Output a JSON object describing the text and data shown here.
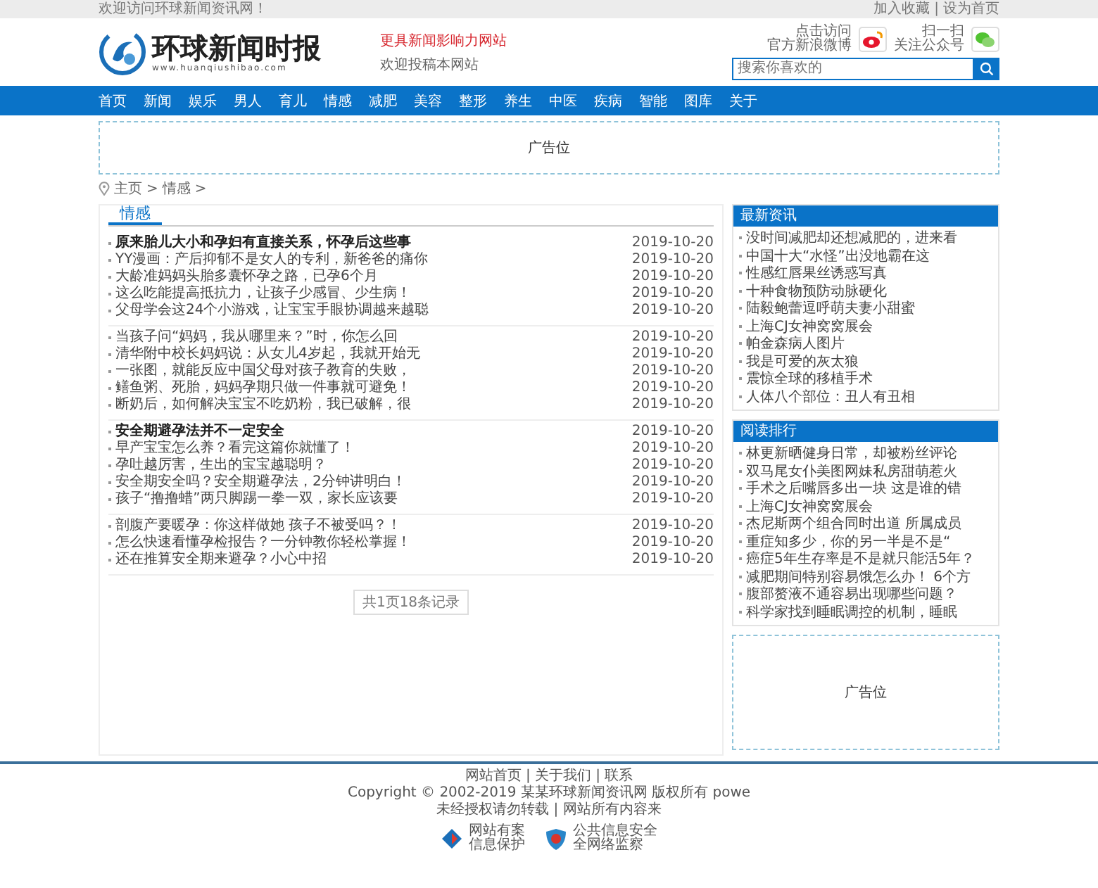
{
  "topbar": {
    "welcome": "欢迎访问环球新闻资讯网！",
    "links": [
      "加入收藏",
      "设为首页"
    ],
    "separator": "|"
  },
  "header": {
    "logo_title": "环球新闻时报",
    "logo_url": "www.huanqiushibao.com",
    "slogan": "更具新闻影响力网站",
    "slogan_sub": "欢迎投稿本网站",
    "weibo_lines": [
      "点击访问",
      "官方新浪微博"
    ],
    "wechat_lines": [
      "扫一扫",
      "关注公众号"
    ],
    "search": {
      "placeholder": "搜索你喜欢的"
    }
  },
  "nav": [
    "首页",
    "新闻",
    "娱乐",
    "男人",
    "育儿",
    "情感",
    "减肥",
    "美容",
    "整形",
    "养生",
    "中医",
    "疾病",
    "智能",
    "图库",
    "关于"
  ],
  "ad_banner": "广告位",
  "breadcrumb": [
    "主页",
    "情感"
  ],
  "breadcrumb_separator": ">",
  "section": {
    "title": "情感",
    "groups": [
      [
        {
          "title": "原来胎儿大小和孕妇有直接关系，怀孕后这些事",
          "date": "2019-10-20",
          "featured": true
        },
        {
          "title": "YY漫画：产后抑郁不是女人的专利，新爸爸的痛你",
          "date": "2019-10-20",
          "featured": false
        },
        {
          "title": "大龄准妈妈头胎多囊怀孕之路，已孕6个月",
          "date": "2019-10-20",
          "featured": false
        },
        {
          "title": "这么吃能提高抵抗力，让孩子少感冒、少生病！",
          "date": "2019-10-20",
          "featured": false
        },
        {
          "title": "父母学会这24个小游戏，让宝宝手眼协调越来越聪",
          "date": "2019-10-20",
          "featured": false
        }
      ],
      [
        {
          "title": "当孩子问“妈妈，我从哪里来？”时，你怎么回",
          "date": "2019-10-20",
          "featured": false
        },
        {
          "title": "清华附中校长妈妈说：从女儿4岁起，我就开始无",
          "date": "2019-10-20",
          "featured": false
        },
        {
          "title": "一张图，就能反应中国父母对孩子教育的失败，",
          "date": "2019-10-20",
          "featured": false
        },
        {
          "title": "鳝鱼粥、死胎，妈妈孕期只做一件事就可避免！",
          "date": "2019-10-20",
          "featured": false
        },
        {
          "title": "断奶后，如何解决宝宝不吃奶粉，我已破解，很",
          "date": "2019-10-20",
          "featured": false
        }
      ],
      [
        {
          "title": "安全期避孕法并不一定安全",
          "date": "2019-10-20",
          "featured": true
        },
        {
          "title": "早产宝宝怎么养？看完这篇你就懂了！",
          "date": "2019-10-20",
          "featured": false
        },
        {
          "title": "孕吐越厉害，生出的宝宝越聪明？",
          "date": "2019-10-20",
          "featured": false
        },
        {
          "title": "安全期安全吗？安全期避孕法，2分钟讲明白！",
          "date": "2019-10-20",
          "featured": false
        },
        {
          "title": "孩子“撸撸蜡”两只脚踢一拳一双，家长应该要",
          "date": "2019-10-20",
          "featured": false
        }
      ],
      [
        {
          "title": "剖腹产要暖孕：你这样做她 孩子不被受吗？！",
          "date": "2019-10-20",
          "featured": false
        },
        {
          "title": "怎么快速看懂孕检报告？一分钟教你轻松掌握！",
          "date": "2019-10-20",
          "featured": false
        },
        {
          "title": "还在推算安全期来避孕？小心中招",
          "date": "2019-10-20",
          "featured": false
        }
      ]
    ]
  },
  "pagination": "共1页18条记录",
  "sidebar": [
    {
      "title": "最新资讯",
      "items": [
        "没时间减肥却还想减肥的，进来看",
        "中国十大“水怪”出没地霸在这",
        "性感红唇果丝诱惑写真",
        "十种食物预防动脉硬化",
        "陆毅鲍蕾逗呼萌夫妻小甜蜜",
        "上海CJ女神窝窝展会",
        "帕金森病人图片",
        "我是可爱的灰太狼",
        "震惊全球的移植手术",
        "人体八个部位：丑人有丑相"
      ]
    },
    {
      "title": "阅读排行",
      "items": [
        "林更新晒健身日常，却被粉丝评论",
        "双马尾女仆美图网妹私房甜萌惹火",
        "手术之后嘴唇多出一块 这是谁的错",
        "上海CJ女神窝窝展会",
        "杰尼斯两个组合同时出道 所属成员",
        "重症知多少，你的另一半是不是“",
        "癌症5年生存率是不是就只能活5年？",
        "减肥期间特别容易饿怎么办！ 6个方",
        "腹部赘液不通容易出现哪些问题？",
        "科学家找到睡眠调控的机制，睡眠"
      ]
    }
  ],
  "sidebar_ad": "广告位",
  "footer": {
    "links": "网站首页 | 关于我们 | 联系",
    "copyright": "Copyright © 2002-2019 某某环球新闻资讯网 版权所有 powe",
    "notice": "未经授权请勿转载 | 网站所有内容来",
    "badges": [
      {
        "kind": "shield",
        "lines": [
          "网站有案",
          "信息保护"
        ]
      },
      {
        "kind": "police",
        "lines": [
          "公共信息安全",
          "全网络监察"
        ]
      }
    ]
  }
}
